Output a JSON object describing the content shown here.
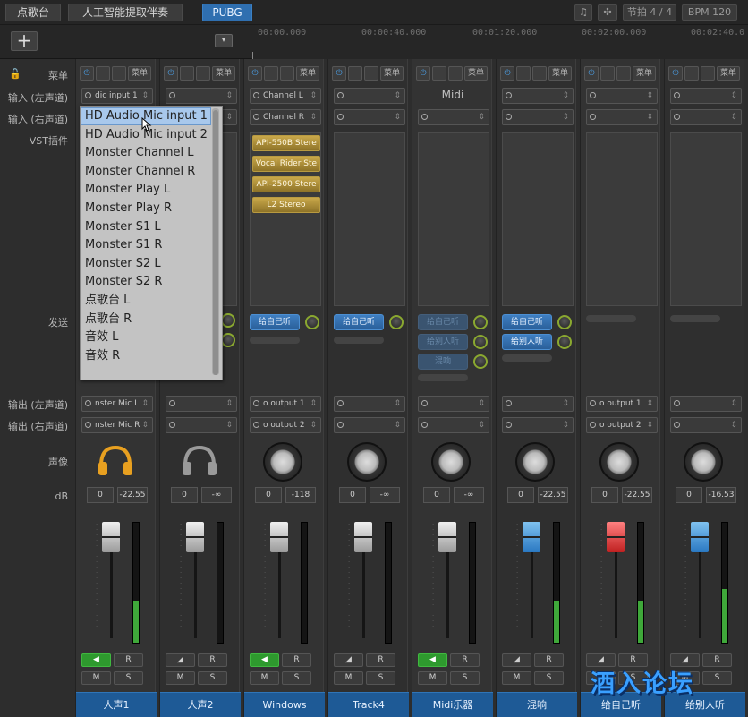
{
  "top_tabs": [
    "点歌台",
    "人工智能提取伴奏",
    "PUBG"
  ],
  "top_right": {
    "beat": "节拍 4 / 4",
    "bpm": "BPM 120"
  },
  "add_label": "+",
  "ruler": [
    "00:00.000",
    "00:00:40.000",
    "00:01:20.000",
    "00:02:00.000",
    "00:02:40.0"
  ],
  "row_labels": {
    "menu": "菜单",
    "input_left": "输入 (左声道)",
    "input_right": "输入 (右声道)",
    "vst": "VST插件",
    "send": "发送",
    "output_left": "输出 (左声道)",
    "output_right": "输出 (右声道)",
    "pan": "声像",
    "db": "dB"
  },
  "menu_btn": "菜单",
  "send_labels": {
    "self": "给自己听",
    "others": "给别人听",
    "reverb": "混响"
  },
  "midi_title": "Midi",
  "plugins": [
    "API-550B Stere",
    "Vocal Rider Ste",
    "API-2500 Stere",
    "L2 Stereo"
  ],
  "strips": [
    {
      "name": "人声1",
      "in_l": "dic input 1",
      "in_r": "",
      "out_l": "nster Mic L",
      "out_r": "nster Mic R",
      "db_l": "0",
      "db_r": "-22.55",
      "meter": 0.35,
      "fader": "white",
      "monitor": true
    },
    {
      "name": "人声2",
      "in_l": "",
      "in_r": "",
      "out_l": "",
      "out_r": "",
      "db_l": "0",
      "db_r": "-∞",
      "meter": 0.0,
      "fader": "white",
      "monitor": false
    },
    {
      "name": "Windows",
      "in_l": "Channel L",
      "in_r": "Channel R",
      "out_l": "o output 1",
      "out_r": "o output 2",
      "db_l": "0",
      "db_r": "-118",
      "meter": 0.0,
      "fader": "white",
      "monitor": true
    },
    {
      "name": "Track4",
      "in_l": "",
      "in_r": "",
      "out_l": "",
      "out_r": "",
      "db_l": "0",
      "db_r": "-∞",
      "meter": 0.0,
      "fader": "white",
      "monitor": false
    },
    {
      "name": "Midi乐器",
      "in_l": "",
      "in_r": "",
      "out_l": "",
      "out_r": "",
      "db_l": "0",
      "db_r": "-∞",
      "meter": 0.0,
      "fader": "white",
      "monitor": true
    },
    {
      "name": "混响",
      "in_l": "",
      "in_r": "",
      "out_l": "",
      "out_r": "",
      "db_l": "0",
      "db_r": "-22.55",
      "meter": 0.35,
      "fader": "blue",
      "monitor": false
    },
    {
      "name": "给自己听",
      "in_l": "",
      "in_r": "",
      "out_l": "o output 1",
      "out_r": "o output 2",
      "db_l": "0",
      "db_r": "-22.55",
      "meter": 0.35,
      "fader": "red",
      "monitor": false
    },
    {
      "name": "给别人听",
      "in_l": "",
      "in_r": "",
      "out_l": "",
      "out_r": "",
      "db_l": "0",
      "db_r": "-16.53",
      "meter": 0.45,
      "fader": "blue",
      "monitor": false
    }
  ],
  "dropdown": {
    "items": [
      "HD Audio Mic input 1",
      "HD Audio Mic input 2",
      "Monster Channel L",
      "Monster Channel R",
      "Monster Play L",
      "Monster Play R",
      "Monster S1 L",
      "Monster S1 R",
      "Monster S2 L",
      "Monster S2 R",
      "点歌台 L",
      "点歌台 R",
      "音效 L",
      "音效 R"
    ],
    "selected": 0
  },
  "watermark": "酒入论坛",
  "rm": {
    "r": "R",
    "m": "M",
    "s": "S"
  },
  "colors": {
    "accent": "#2f6fb0",
    "plugin": "#c9a84a",
    "meter": "#3fa83a",
    "headphones_active": "#e8a020"
  }
}
